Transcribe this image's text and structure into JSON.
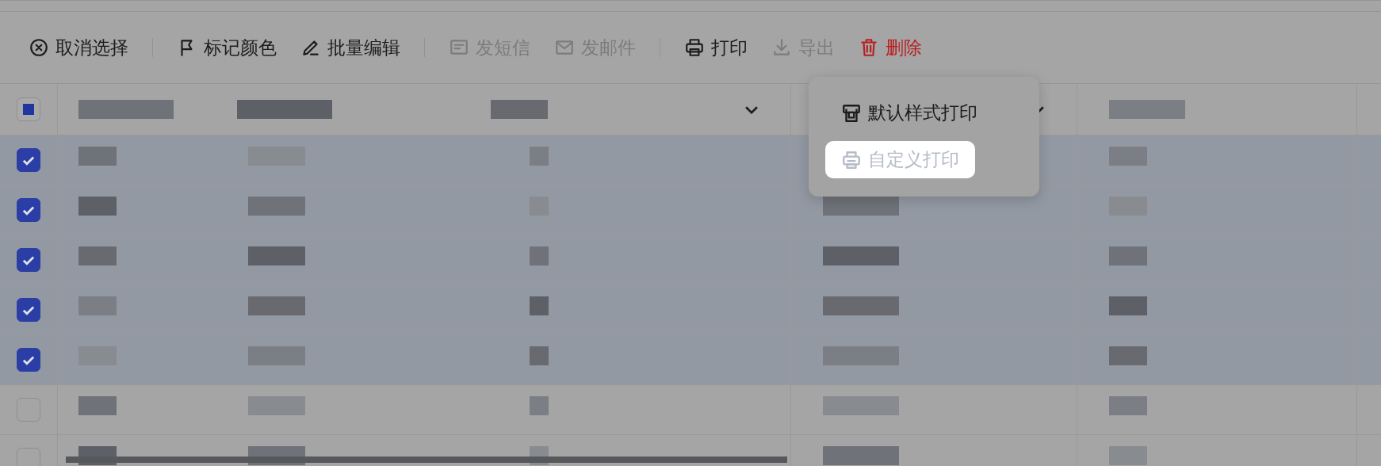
{
  "toolbar": [
    {
      "label": "取消选择",
      "disabled": false,
      "kind": "normal"
    },
    {
      "label": "标记颜色",
      "disabled": false,
      "kind": "normal"
    },
    {
      "label": "批量编辑",
      "disabled": false,
      "kind": "normal"
    },
    {
      "label": "发短信",
      "disabled": true,
      "kind": "normal"
    },
    {
      "label": "发邮件",
      "disabled": true,
      "kind": "normal"
    },
    {
      "label": "打印",
      "disabled": false,
      "kind": "normal"
    },
    {
      "label": "导出",
      "disabled": true,
      "kind": "normal"
    },
    {
      "label": "删除",
      "disabled": false,
      "kind": "danger"
    }
  ],
  "print_menu": [
    {
      "label": "默认样式打印",
      "disabled": false,
      "highlighted": false
    },
    {
      "label": "自定义打印",
      "disabled": true,
      "highlighted": true
    }
  ],
  "table": {
    "header_checkbox": {
      "indeterminate": true
    },
    "columns": [
      {
        "has_dropdown": true
      },
      {
        "has_dropdown": true
      },
      {
        "has_dropdown": false
      }
    ],
    "rows": [
      {
        "checked": true
      },
      {
        "checked": true
      },
      {
        "checked": true
      },
      {
        "checked": true
      },
      {
        "checked": true
      },
      {
        "checked": false
      },
      {
        "checked": false
      }
    ]
  }
}
